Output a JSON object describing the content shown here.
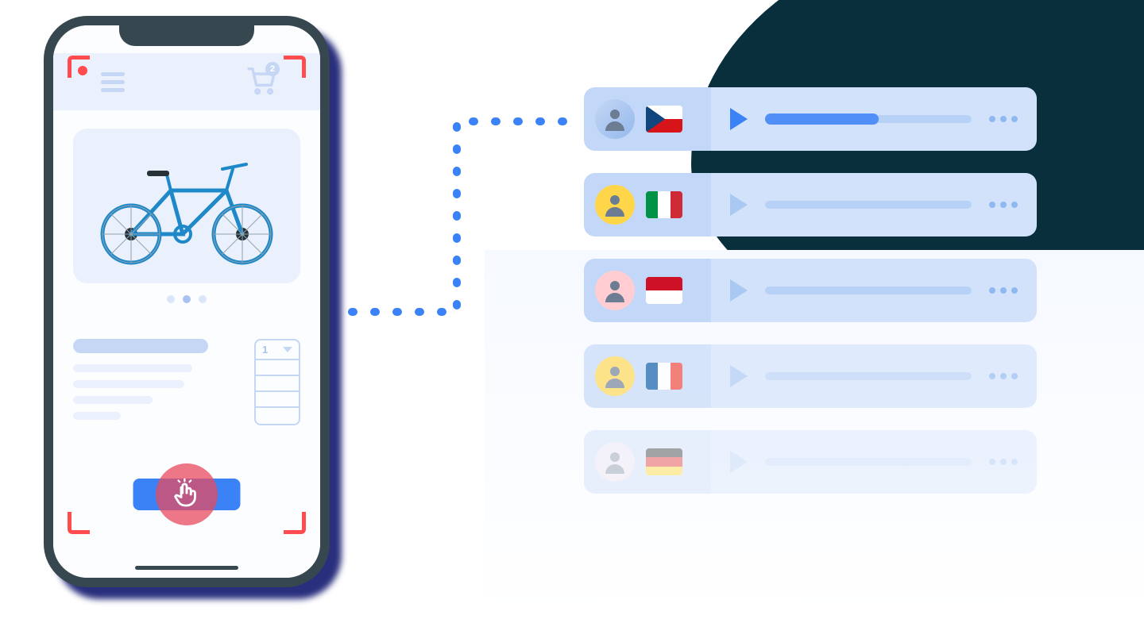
{
  "phone": {
    "cart_count": "2",
    "qty_value": "1",
    "product": "bicycle",
    "pager_active_index": 1,
    "pager_count": 3
  },
  "rows": [
    {
      "flag": "cz",
      "flag_label": "Czech",
      "avatar": "av1",
      "active": true,
      "fade": 0
    },
    {
      "flag": "it",
      "flag_label": "Italian",
      "avatar": "av2",
      "active": false,
      "fade": 0
    },
    {
      "flag": "id",
      "flag_label": "Indonesian",
      "avatar": "av3",
      "active": false,
      "fade": 0
    },
    {
      "flag": "fr",
      "flag_label": "French",
      "avatar": "av4",
      "active": false,
      "fade": 1
    },
    {
      "flag": "de",
      "flag_label": "German",
      "avatar": "av5",
      "active": false,
      "fade": 2
    }
  ],
  "colors": {
    "accent": "#3b82f6",
    "pale": "#c5d7f5",
    "record": "#ff4d4f"
  }
}
